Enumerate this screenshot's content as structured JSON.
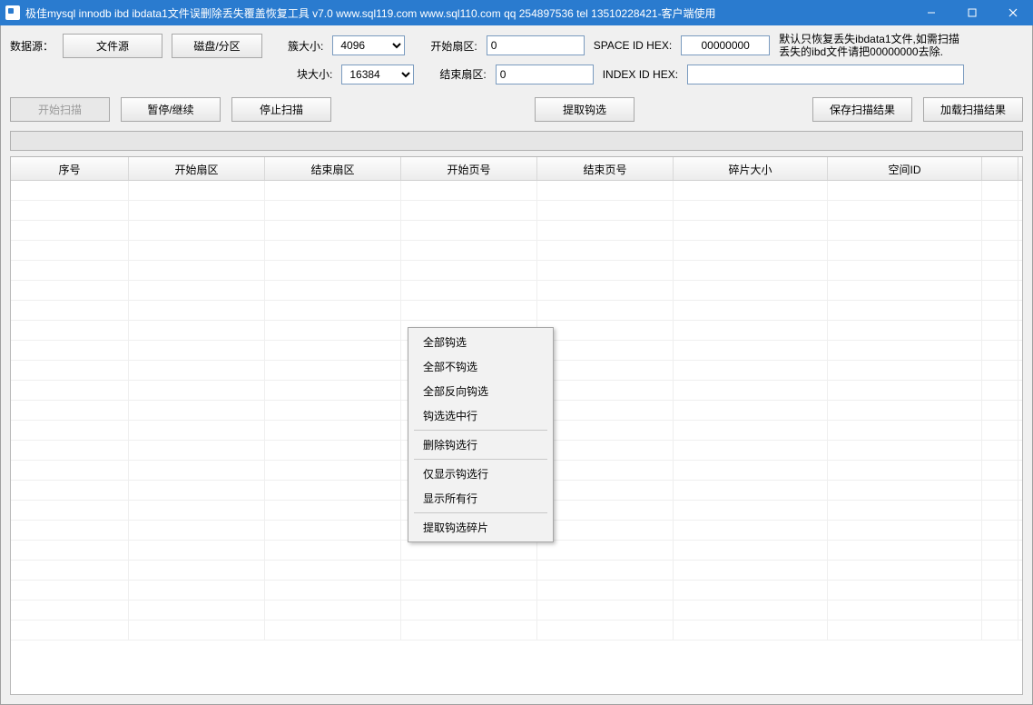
{
  "window": {
    "title": "极佳mysql innodb ibd ibdata1文件误删除丢失覆盖恢复工具 v7.0 www.sql119.com www.sql110.com qq 254897536 tel 13510228421-客户端使用"
  },
  "labels": {
    "data_source": "数据源：",
    "cluster_size": "簇大小:",
    "block_size": "块大小:",
    "start_sector": "开始扇区:",
    "end_sector": "结束扇区:",
    "space_id": "SPACE ID HEX:",
    "index_id": "INDEX ID HEX:"
  },
  "buttons": {
    "file_source": "文件源",
    "disk_partition": "磁盘/分区",
    "start_scan": "开始扫描",
    "pause_resume": "暂停/继续",
    "stop_scan": "停止扫描",
    "extract_checked": "提取钩选",
    "save_result": "保存扫描结果",
    "load_result": "加载扫描结果"
  },
  "combos": {
    "cluster_size": "4096",
    "block_size": "16384"
  },
  "inputs": {
    "start_sector": "0",
    "end_sector": "0",
    "space_id": "00000000",
    "index_id": ""
  },
  "note": "默认只恢复丢失ibdata1文件,如需扫描丢失的ibd文件请把00000000去除.",
  "columns": [
    "序号",
    "开始扇区",
    "结束扇区",
    "开始页号",
    "结束页号",
    "碎片大小",
    "空间ID",
    ""
  ],
  "context_menu": {
    "select_all": "全部钩选",
    "deselect_all": "全部不钩选",
    "invert": "全部反向钩选",
    "select_row": "钩选选中行",
    "delete_checked": "删除钩选行",
    "show_checked": "仅显示钩选行",
    "show_all": "显示所有行",
    "extract_fragments": "提取钩选碎片"
  }
}
